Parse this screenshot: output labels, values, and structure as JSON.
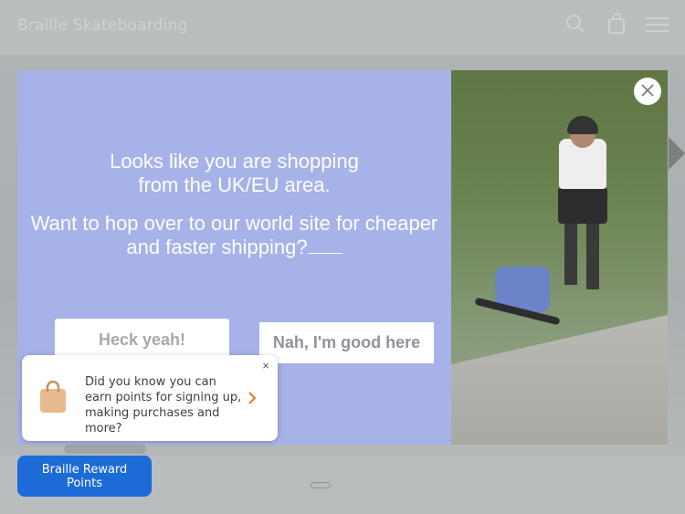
{
  "header": {
    "brand": "Braille Skateboarding",
    "icons": [
      "search-icon",
      "bag-icon",
      "menu-icon"
    ]
  },
  "modal": {
    "message_line1": "Looks like you are shopping",
    "message_line2": "from the UK/EU area.",
    "question_line1": "Want to hop over to our world site for cheaper",
    "question_line2": "and faster shipping?",
    "yes_label": "Heck yeah!",
    "no_label": "Nah, I'm good here",
    "background_color": "#a7b2e9"
  },
  "toast": {
    "text": "Did you know you can earn points for signing up, making purchases and more?",
    "close_label": "×"
  },
  "reward_button": {
    "label": "Braille Reward Points",
    "color": "#1c6bd6"
  }
}
